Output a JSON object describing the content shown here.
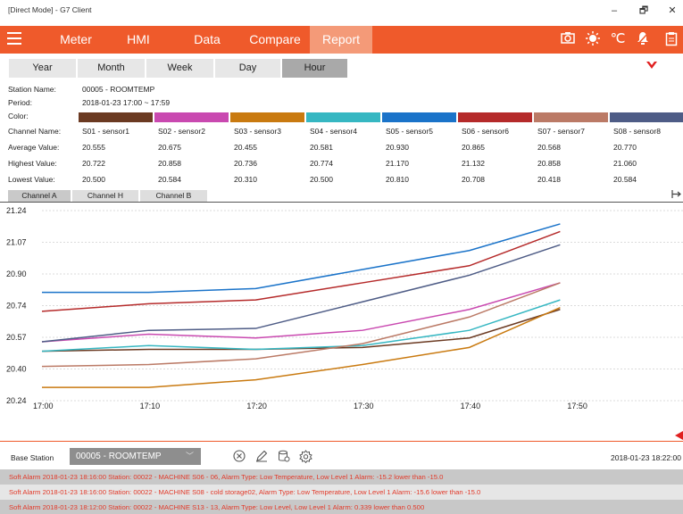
{
  "window": {
    "title": "[Direct Mode] - G7 Client",
    "minimize": "–",
    "restore": "🗗",
    "close": "✕"
  },
  "menu": {
    "items": [
      {
        "label": "Meter"
      },
      {
        "label": "HMI"
      },
      {
        "label": "Data"
      },
      {
        "label": "Compare"
      },
      {
        "label": "Report"
      }
    ],
    "active": "Report",
    "accent": "#ef5a2b",
    "tools": [
      "camera-icon",
      "sun-icon",
      "celsius-icon",
      "alarm-bell-icon",
      "document-icon"
    ]
  },
  "period_tabs": [
    {
      "label": "Year"
    },
    {
      "label": "Month"
    },
    {
      "label": "Week"
    },
    {
      "label": "Day"
    },
    {
      "label": "Hour"
    }
  ],
  "period_active": "Hour",
  "info": {
    "station_label": "Station Name:",
    "station_value": "00005 - ROOMTEMP",
    "period_label": "Period:",
    "period_value": "2018-01-23  17:00 ~ 17:59",
    "color_label": "Color:",
    "channel_label": "Channel Name:",
    "avg_label": "Average Value:",
    "high_label": "Highest Value:",
    "low_label": "Lowest Value:"
  },
  "channels": [
    {
      "name": "S01 - sensor1",
      "avg": "20.555",
      "high": "20.722",
      "low": "20.500",
      "color": "#6b3a22"
    },
    {
      "name": "S02 - sensor2",
      "avg": "20.675",
      "high": "20.858",
      "low": "20.584",
      "color": "#c949b0"
    },
    {
      "name": "S03 - sensor3",
      "avg": "20.455",
      "high": "20.736",
      "low": "20.310",
      "color": "#c97a10"
    },
    {
      "name": "S04 - sensor4",
      "avg": "20.581",
      "high": "20.774",
      "low": "20.500",
      "color": "#36b7c2"
    },
    {
      "name": "S05 - sensor5",
      "avg": "20.930",
      "high": "21.170",
      "low": "20.810",
      "color": "#1a73c9"
    },
    {
      "name": "S06 - sensor6",
      "avg": "20.865",
      "high": "21.132",
      "low": "20.708",
      "color": "#b52a2a"
    },
    {
      "name": "S07 - sensor7",
      "avg": "20.568",
      "high": "20.858",
      "low": "20.418",
      "color": "#bb7a66"
    },
    {
      "name": "S08 - sensor8",
      "avg": "20.770",
      "high": "21.060",
      "low": "20.584",
      "color": "#4e5c86"
    }
  ],
  "channel_tabs": [
    {
      "label": "Channel A"
    },
    {
      "label": "Channel H"
    },
    {
      "label": "Channel B"
    }
  ],
  "channel_tab_active": "Channel A",
  "chart_data": {
    "type": "line",
    "x": [
      "17:00",
      "17:10",
      "17:20",
      "17:30",
      "17:40",
      "17:50"
    ],
    "x_values": [
      0,
      10,
      20,
      30,
      40,
      50
    ],
    "yticks": [
      "21.24",
      "21.07",
      "20.90",
      "20.74",
      "20.57",
      "20.40",
      "20.24"
    ],
    "ylim": [
      20.24,
      21.24
    ],
    "xlim": [
      0,
      60
    ],
    "grid": true,
    "series": [
      {
        "values_x": [
          0,
          10,
          20,
          30,
          40,
          48.5
        ],
        "values": [
          20.5,
          20.51,
          20.51,
          20.52,
          20.57,
          20.72
        ],
        "color": "#6b3a22"
      },
      {
        "values_x": [
          0,
          10,
          20,
          30,
          40,
          48.5
        ],
        "values": [
          20.55,
          20.59,
          20.57,
          20.61,
          20.72,
          20.86
        ],
        "color": "#c949b0"
      },
      {
        "values_x": [
          0,
          10,
          20,
          30,
          40,
          48.5
        ],
        "values": [
          20.31,
          20.31,
          20.35,
          20.43,
          20.52,
          20.73
        ],
        "color": "#c97a10"
      },
      {
        "values_x": [
          0,
          10,
          20,
          30,
          40,
          48.5
        ],
        "values": [
          20.5,
          20.53,
          20.51,
          20.53,
          20.61,
          20.77
        ],
        "color": "#36b7c2"
      },
      {
        "values_x": [
          0,
          10,
          20,
          30,
          40,
          48.5
        ],
        "values": [
          20.81,
          20.81,
          20.83,
          20.93,
          21.03,
          21.17
        ],
        "color": "#1a73c9"
      },
      {
        "values_x": [
          0,
          10,
          20,
          30,
          40,
          48.5
        ],
        "values": [
          20.71,
          20.75,
          20.77,
          20.86,
          20.95,
          21.13
        ],
        "color": "#b52a2a"
      },
      {
        "values_x": [
          0,
          10,
          20,
          30,
          40,
          48.5
        ],
        "values": [
          20.42,
          20.43,
          20.46,
          20.54,
          20.68,
          20.86
        ],
        "color": "#bb7a66"
      },
      {
        "values_x": [
          0,
          10,
          20,
          30,
          40,
          48.5
        ],
        "values": [
          20.55,
          20.61,
          20.62,
          20.76,
          20.9,
          21.06
        ],
        "color": "#4e5c86"
      }
    ]
  },
  "bottom": {
    "label": "Base Station",
    "station": "00005 - ROOMTEMP",
    "icons": [
      "clear-icon",
      "edit-icon",
      "database-settings-icon",
      "settings-icon"
    ],
    "datetime": "2018-01-23 18:22:00"
  },
  "alarms": [
    "Soft Alarm   2018-01-23 18:16:00   Station: 00022 - MACHINE   S06 - 06, Alarm Type: Low Temperature, Low Level 1 Alarm: -15.2 lower than -15.0",
    "Soft Alarm   2018-01-23 18:16:00   Station: 00022 - MACHINE   S08 - cold storage02, Alarm Type: Low Temperature, Low Level 1 Alarm: -15.6 lower than -15.0",
    "Soft Alarm   2018-01-23 18:12:00   Station: 00022 - MACHINE   S13 - 13, Alarm Type: Low Level, Low Level 1 Alarm: 0.339 lower than 0.500"
  ]
}
